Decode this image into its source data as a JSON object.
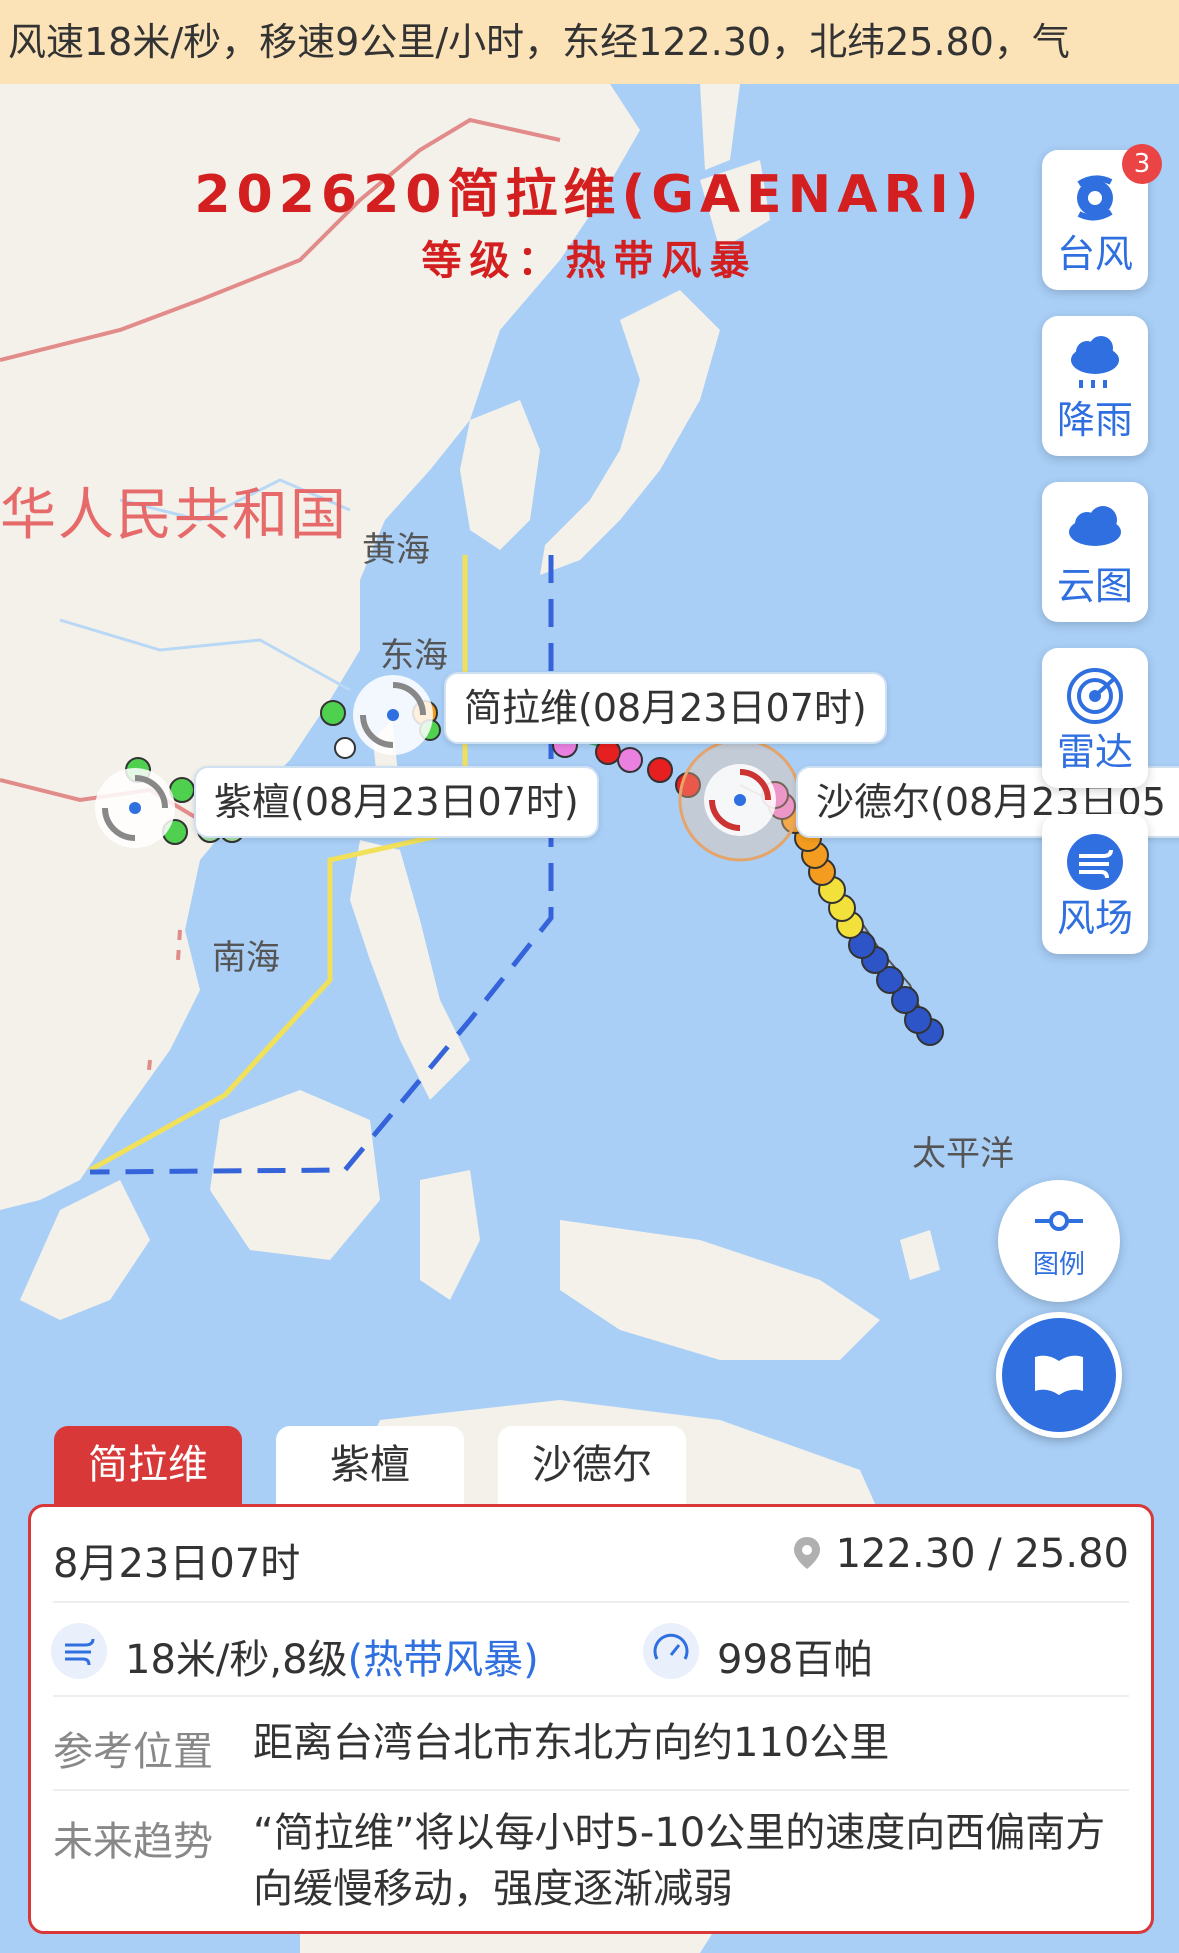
{
  "ticker_text": "风速18米/秒，移速9公里/小时，东经122.30，北纬25.80，气",
  "storm": {
    "title": "202620简拉维(GAENARI)",
    "grade": "等级：热带风暴"
  },
  "map_labels": {
    "country": "华人民共和国",
    "yellow_sea": "黄海",
    "east_sea": "东海",
    "south_sea": "南海",
    "pacific": "太平洋"
  },
  "tooltips": {
    "gaenari": "简拉维(08月23日07时)",
    "zitan": "紫檀(08月23日07时)",
    "shadeer": "沙德尔(08月23日05"
  },
  "side_buttons": [
    {
      "label": "台风",
      "icon": "typhoon-icon",
      "badge": "3"
    },
    {
      "label": "降雨",
      "icon": "rain-cloud-icon"
    },
    {
      "label": "云图",
      "icon": "cloud-icon"
    },
    {
      "label": "雷达",
      "icon": "radar-icon"
    },
    {
      "label": "风场",
      "icon": "wind-icon"
    }
  ],
  "legend_button": {
    "label": "图例",
    "icon": "legend-icon"
  },
  "guide_button": {
    "icon": "book-icon"
  },
  "tabs": [
    {
      "label": "简拉维",
      "active": true
    },
    {
      "label": "紫檀",
      "active": false
    },
    {
      "label": "沙德尔",
      "active": false
    }
  ],
  "info": {
    "datetime": "8月23日07时",
    "coordinates": "122.30 / 25.80",
    "wind": "18米/秒,8级",
    "wind_grade": "(热带风暴)",
    "pressure": "998百帕",
    "ref_label": "参考位置",
    "ref_value": "距离台湾台北市东北方向约110公里",
    "trend_label": "未来趋势",
    "trend_value": "“简拉维”将以每小时5-10公里的速度向西偏南方向缓慢移动，强度逐渐减弱"
  },
  "colors": {
    "accent_red": "#d93838",
    "accent_blue": "#2f6fe0",
    "sea": "#a9cff7",
    "land": "#f4f1ea"
  }
}
